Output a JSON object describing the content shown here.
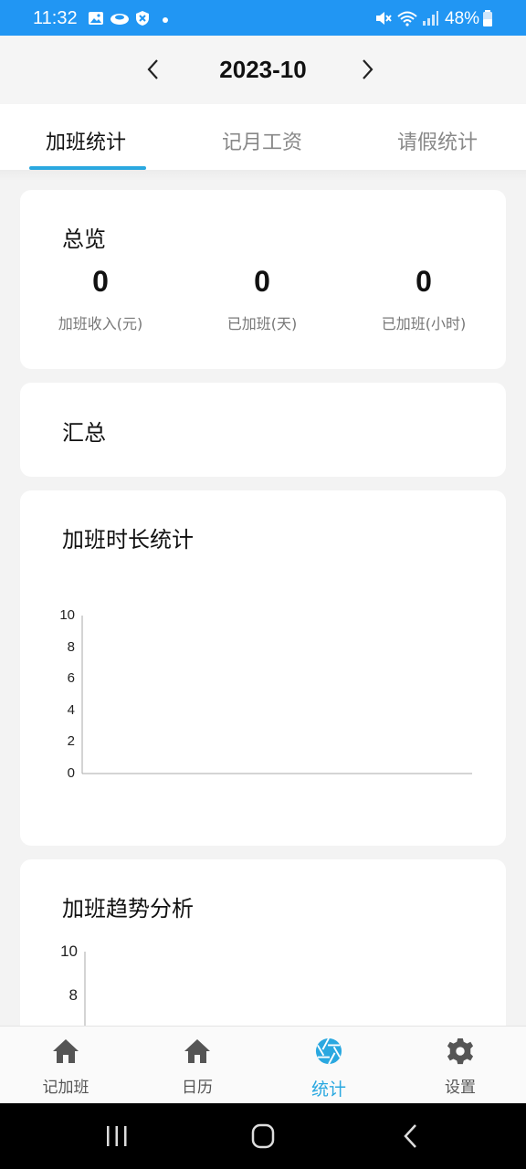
{
  "status_bar": {
    "time": "11:32",
    "battery": "48%",
    "left_icons": [
      "image-icon",
      "cloud-icon",
      "shield-icon",
      "dot-icon"
    ],
    "right_icons": [
      "mute-icon",
      "wifi-icon",
      "signal-icon",
      "battery-icon"
    ]
  },
  "header": {
    "month": "2023-10",
    "prev_icon": "chevron-left-icon",
    "next_icon": "chevron-right-icon"
  },
  "tabs": [
    {
      "label": "加班统计",
      "active": true
    },
    {
      "label": "记月工资",
      "active": false
    },
    {
      "label": "请假统计",
      "active": false
    }
  ],
  "overview": {
    "title": "总览",
    "stats": [
      {
        "value": "0",
        "label": "加班收入(元)"
      },
      {
        "value": "0",
        "label": "已加班(天)"
      },
      {
        "value": "0",
        "label": "已加班(小时)"
      }
    ]
  },
  "summary": {
    "title": "汇总"
  },
  "duration_chart": {
    "title": "加班时长统计",
    "chart_data": {
      "type": "bar",
      "title": "",
      "categories": [],
      "values": [],
      "ylim": [
        0,
        10
      ],
      "yticks": [
        "10",
        "8",
        "6",
        "4",
        "2",
        "0"
      ],
      "grid": false
    }
  },
  "trend_chart": {
    "title": "加班趋势分析",
    "chart_data": {
      "type": "line",
      "title": "",
      "x": [],
      "values": [],
      "ylim": [
        0,
        10
      ],
      "yticks_visible": [
        "10",
        "8"
      ],
      "grid": false
    }
  },
  "bottom_nav": [
    {
      "label": "记加班",
      "icon": "home-icon",
      "active": false
    },
    {
      "label": "日历",
      "icon": "home-icon",
      "active": false
    },
    {
      "label": "统计",
      "icon": "aperture-icon",
      "active": true
    },
    {
      "label": "设置",
      "icon": "gear-icon",
      "active": false
    }
  ],
  "colors": {
    "status_bar": "#2196f3",
    "accent": "#2aa8e0",
    "background": "#f3f3f3"
  }
}
